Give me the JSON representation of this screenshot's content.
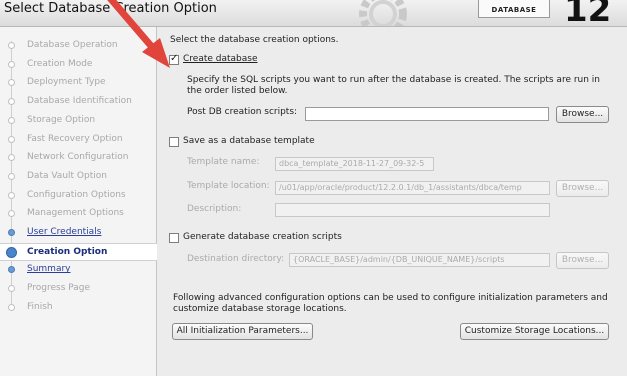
{
  "header": {
    "title": "Select Database Creation Option",
    "db_label": "DATABASE",
    "version": "12"
  },
  "sidebar": {
    "items": [
      {
        "label": "Database Operation",
        "state": "done"
      },
      {
        "label": "Creation Mode",
        "state": "done"
      },
      {
        "label": "Deployment Type",
        "state": "done"
      },
      {
        "label": "Database Identification",
        "state": "done"
      },
      {
        "label": "Storage Option",
        "state": "done"
      },
      {
        "label": "Fast Recovery Option",
        "state": "done"
      },
      {
        "label": "Network Configuration",
        "state": "done"
      },
      {
        "label": "Data Vault Option",
        "state": "done"
      },
      {
        "label": "Configuration Options",
        "state": "done"
      },
      {
        "label": "Management Options",
        "state": "done"
      },
      {
        "label": "User Credentials",
        "state": "link"
      },
      {
        "label": "Creation Option",
        "state": "current"
      },
      {
        "label": "Summary",
        "state": "link"
      },
      {
        "label": "Progress Page",
        "state": "pending"
      },
      {
        "label": "Finish",
        "state": "pending"
      }
    ]
  },
  "main": {
    "intro": "Select the database creation options.",
    "create_db": {
      "checked": true,
      "label": "Create database",
      "desc_line1": "Specify the SQL scripts you want to run after the database is created. The scripts are run in",
      "desc_line2": "the order listed below.",
      "post_label": "Post DB creation scripts:",
      "post_value": "",
      "browse": "Browse..."
    },
    "template": {
      "checked": false,
      "label": "Save as a database template",
      "name_label": "Template name:",
      "name_value": "dbca_template_2018-11-27_09-32-5",
      "location_label": "Template location:",
      "location_value": "/u01/app/oracle/product/12.2.0.1/db_1/assistants/dbca/temp",
      "browse": "Browse...",
      "desc_label": "Description:",
      "desc_value": ""
    },
    "scripts": {
      "checked": false,
      "label": "Generate database creation scripts",
      "dest_label": "Destination directory:",
      "dest_value": "{ORACLE_BASE}/admin/{DB_UNIQUE_NAME}/scripts",
      "browse": "Browse..."
    },
    "advanced_line1": "Following advanced configuration options can be used to configure initialization parameters and",
    "advanced_line2": "customize database storage locations.",
    "init_params_button": "All Initialization Parameters...",
    "storage_button": "Customize Storage Locations..."
  },
  "colors": {
    "annotation_arrow": "#e0443a",
    "current_step": "#1b2e7a",
    "link": "#2a3f9a"
  }
}
